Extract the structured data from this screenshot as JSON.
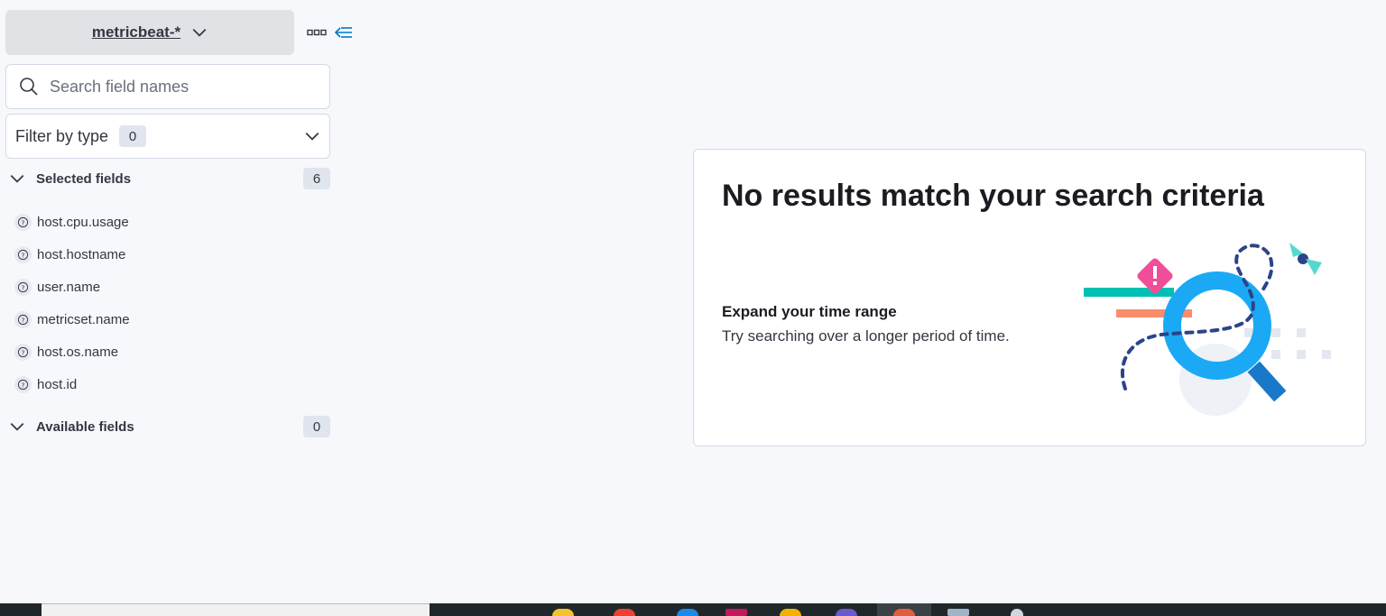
{
  "sidebar": {
    "index_pattern": "metricbeat-*",
    "search": {
      "placeholder": "Search field names",
      "value": ""
    },
    "filter": {
      "label": "Filter by type",
      "count": "0"
    },
    "selected_fields": {
      "title": "Selected fields",
      "count": "6",
      "items": [
        "host.cpu.usage",
        "host.hostname",
        "user.name",
        "metricset.name",
        "host.os.name",
        "host.id"
      ]
    },
    "available_fields": {
      "title": "Available fields",
      "count": "0"
    }
  },
  "empty_state": {
    "title": "No results match your search criteria",
    "suggestion_title": "Expand your time range",
    "suggestion_text": "Try searching over a longer period of time."
  },
  "colors": {
    "accent": "#0077cc",
    "badge_bg": "#e0e5ee",
    "illustration_blue": "#1ba9f5",
    "illustration_pink": "#f04e98",
    "illustration_teal": "#00bfb3",
    "illustration_salmon": "#fa8c6e",
    "illustration_navy": "#2b4488"
  },
  "icons": {
    "index_pattern_chevron": "chevron-down-icon",
    "more": "boxes-horizontal-icon",
    "collapse": "menu-left-icon",
    "search": "search-icon",
    "filter_chevron": "chevron-down-icon",
    "field_type": "question-icon",
    "illustration": "magnifying-glass-illustration"
  }
}
